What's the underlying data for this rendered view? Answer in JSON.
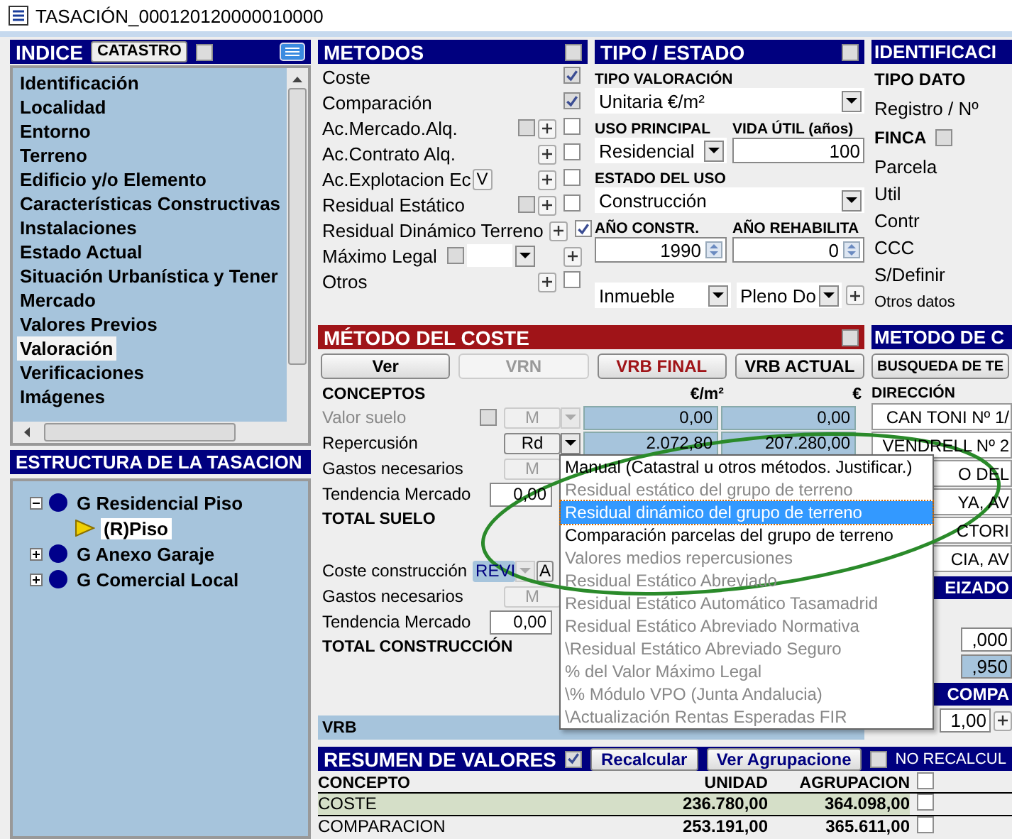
{
  "window": {
    "title": "TASACIÓN_000120120000010000"
  },
  "indice": {
    "title": "INDICE",
    "button": "CATASTRO",
    "checked": false,
    "items": [
      {
        "label": "Identificación",
        "selected": false
      },
      {
        "label": "Localidad",
        "selected": false
      },
      {
        "label": "Entorno",
        "selected": false
      },
      {
        "label": "Terreno",
        "selected": false
      },
      {
        "label": "Edificio y/o Elemento",
        "selected": false
      },
      {
        "label": "Características Constructivas",
        "selected": false
      },
      {
        "label": "Instalaciones",
        "selected": false
      },
      {
        "label": "Estado Actual",
        "selected": false
      },
      {
        "label": "Situación Urbanística y Tener",
        "selected": false
      },
      {
        "label": "Mercado",
        "selected": false
      },
      {
        "label": "Valores Previos",
        "selected": false
      },
      {
        "label": "Valoración",
        "selected": true
      },
      {
        "label": "Verificaciones",
        "selected": false
      },
      {
        "label": "Imágenes",
        "selected": false
      }
    ]
  },
  "estructura": {
    "title": "ESTRUCTURA DE LA TASACION",
    "nodes": [
      {
        "label": "G Residencial Piso",
        "expanded": true,
        "selected": false,
        "children": [
          {
            "label": "(R)Piso",
            "selected": true
          }
        ]
      },
      {
        "label": "G Anexo Garaje",
        "expanded": false,
        "selected": false
      },
      {
        "label": "G Comercial Local",
        "expanded": false,
        "selected": false
      }
    ]
  },
  "metodos": {
    "title": "METODOS",
    "checked": false,
    "rows": [
      {
        "label": "Coste",
        "checked": true
      },
      {
        "label": "Comparación",
        "checked": true
      },
      {
        "label": "Ac.Mercado.Alq.",
        "option": false,
        "add": true,
        "checked": false
      },
      {
        "label": "Ac.Contrato Alq.",
        "add": true,
        "checked": false
      },
      {
        "label": "Ac.Explotacion Ec",
        "tag": "V",
        "add": true,
        "checked": false
      },
      {
        "label": "Residual Estático",
        "option": false,
        "add": true,
        "checked": false
      },
      {
        "label": "Residual Dinámico Terreno",
        "add": true,
        "checked": true
      },
      {
        "label": "Máximo Legal",
        "option": false,
        "dropdown": true,
        "add": true
      },
      {
        "label": "Otros",
        "add": true,
        "checked": false
      }
    ]
  },
  "tipo_estado": {
    "title": "TIPO / ESTADO",
    "checked": false,
    "tipo_valoracion": {
      "label": "TIPO VALORACIÓN",
      "value": "Unitaria €/m²"
    },
    "uso_principal": {
      "label": "USO PRINCIPAL",
      "value": "Residencial"
    },
    "vida_util": {
      "label": "VIDA ÚTIL (años)",
      "value": "100"
    },
    "estado_uso": {
      "label": "ESTADO DEL USO",
      "value": "Construcción"
    },
    "ano_constr": {
      "label": "AÑO CONSTR.",
      "value": "1990"
    },
    "ano_rehabilita": {
      "label": "AÑO REHABILITA",
      "value": "0"
    },
    "inmueble": {
      "value": "Inmueble"
    },
    "dominio": {
      "value": "Pleno Do"
    }
  },
  "identificacion": {
    "title": "IDENTIFICACI",
    "rows": [
      {
        "label": "TIPO DATO",
        "kind": "heading"
      },
      {
        "label": "Registro / Nº",
        "kind": "field"
      },
      {
        "label": "FINCA",
        "kind": "heading",
        "checked": false
      },
      {
        "label": "Parcela",
        "kind": "field"
      },
      {
        "label": "Util",
        "kind": "field"
      },
      {
        "label": "Contr",
        "kind": "field"
      },
      {
        "label": "CCC",
        "kind": "field"
      },
      {
        "label": "S/Definir",
        "kind": "field"
      },
      {
        "label": "Otros datos",
        "kind": "small"
      }
    ]
  },
  "metodo_coste": {
    "title": "MÉTODO DEL COSTE",
    "checked": false,
    "buttons": [
      {
        "label": "Ver",
        "disabled": false,
        "highlighted": false
      },
      {
        "label": "VRN",
        "disabled": true,
        "highlighted": false
      },
      {
        "label": "VRB FINAL",
        "disabled": false,
        "highlighted": true
      },
      {
        "label": "VRB ACTUAL",
        "disabled": false,
        "highlighted": false
      }
    ],
    "columns": [
      "CONCEPTOS",
      "€/m²",
      "€"
    ],
    "rows": [
      {
        "kind": "method",
        "label": "Valor suelo",
        "disabled": true,
        "checked": false,
        "method": {
          "label": "M",
          "disabled": true,
          "highlighted": false
        },
        "dropdown": {
          "disabled": true
        },
        "values": [
          "0,00",
          "0,00"
        ]
      },
      {
        "kind": "method",
        "label": "Repercusión",
        "disabled": false,
        "method": {
          "label": "Rd",
          "disabled": false,
          "highlighted": false
        },
        "dropdown": {
          "disabled": false
        },
        "values": [
          "2.072,80",
          "207.280,00"
        ]
      },
      {
        "kind": "method",
        "label": "Gastos necesarios",
        "disabled": false,
        "method": {
          "label": "M",
          "disabled": true,
          "highlighted": false
        }
      },
      {
        "kind": "input",
        "label": "Tendencia Mercado",
        "value": "0,00"
      },
      {
        "kind": "total",
        "label": "TOTAL SUELO"
      },
      {
        "kind": "method",
        "label": "Coste construcción",
        "disabled": false,
        "method": {
          "label": "REVI",
          "disabled": false,
          "highlighted": true
        },
        "dropdown": {
          "disabled": true
        },
        "extra": "A"
      },
      {
        "kind": "method",
        "label": "Gastos necesarios",
        "disabled": false,
        "method": {
          "label": "M",
          "disabled": true,
          "highlighted": false
        }
      },
      {
        "kind": "input",
        "label": "Tendencia Mercado",
        "value": "0,00"
      },
      {
        "kind": "total",
        "label": "TOTAL CONSTRUCCIÓN"
      },
      {
        "kind": "band",
        "label": "VRB"
      }
    ],
    "dropdown": {
      "options": [
        {
          "label": "Manual (Catastral u otros métodos. Justificar.)",
          "disabled": false,
          "selected": false
        },
        {
          "label": "Residual estático del grupo de terreno",
          "disabled": true,
          "selected": false
        },
        {
          "label": "Residual dinámico  del grupo de terreno",
          "disabled": false,
          "selected": true
        },
        {
          "label": "Comparación parcelas  del grupo de terreno",
          "disabled": false,
          "selected": false
        },
        {
          "label": "Valores medios repercusiones",
          "disabled": true,
          "selected": false
        },
        {
          "label": "Residual Estático Abreviado",
          "disabled": true,
          "selected": false
        },
        {
          "label": "Residual Estático Automático Tasamadrid",
          "disabled": true,
          "selected": false
        },
        {
          "label": "Residual Estático Abreviado Normativa",
          "disabled": true,
          "selected": false
        },
        {
          "label": "\\Residual Estático Abreviado Seguro",
          "disabled": true,
          "selected": false
        },
        {
          "label": "% del Valor Máximo Legal",
          "disabled": true,
          "selected": false
        },
        {
          "label": "\\% Módulo VPO (Junta Andalucia)",
          "disabled": true,
          "selected": false
        },
        {
          "label": "\\Actualización Rentas Esperadas FIR",
          "disabled": true,
          "selected": false
        }
      ]
    }
  },
  "metodo_comparacion": {
    "title": "METODO DE C",
    "button": "BUSQUEDA DE TE",
    "column": "DIRECCIÓN",
    "addresses": [
      "CAN TONI Nº 1/",
      "VENDRELL Nº 2",
      "O DEL",
      "YA, AV",
      "CTORI",
      "CIA, AV"
    ],
    "section": "EIZADO",
    "values": [
      {
        "value": ",000",
        "highlighted": false
      },
      {
        "value": ",950",
        "highlighted": true
      }
    ],
    "section2": "COMPA",
    "factor": "1,00"
  },
  "resumen": {
    "title": "RESUMEN DE VALORES",
    "checked": true,
    "buttons": [
      "Recalcular",
      "Ver Agrupacione"
    ],
    "no_recalcular": {
      "label": "NO RECALCUL",
      "checked": false
    },
    "columns": [
      "CONCEPTO",
      "UNIDAD",
      "AGRUPACION"
    ],
    "all_checked": false,
    "rows": [
      {
        "concepto": "COSTE",
        "unidad": "236.780,00",
        "agrupacion": "364.098,00",
        "selected": true,
        "checked": false
      },
      {
        "concepto": "COMPARACION",
        "unidad": "253.191,00",
        "agrupacion": "365.611,00",
        "selected": false,
        "checked": false
      }
    ]
  }
}
